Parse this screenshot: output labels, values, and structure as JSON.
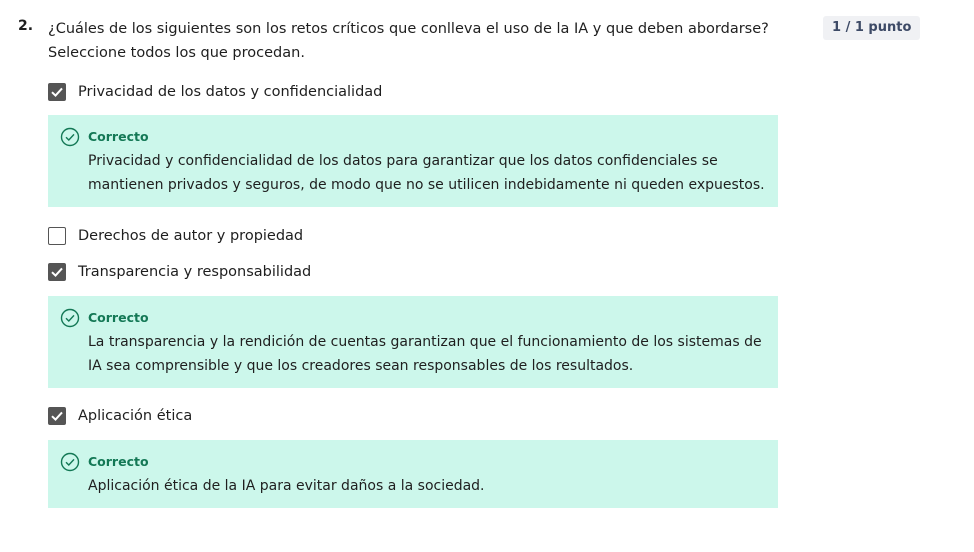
{
  "question": {
    "number": "2.",
    "text": "¿Cuáles de los siguientes son los retos críticos que conlleva el uso de la IA y que deben abordarse? Seleccione todos los que procedan.",
    "score": "1 / 1 punto"
  },
  "options": [
    {
      "label": "Privacidad de los datos y confidencialidad",
      "checked": true,
      "feedback": {
        "title": "Correcto",
        "text": "Privacidad y confidencialidad de los datos para garantizar que los datos confidenciales se mantienen privados y seguros, de modo que no se utilicen indebidamente ni queden expuestos."
      }
    },
    {
      "label": "Derechos de autor y propiedad",
      "checked": false
    },
    {
      "label": "Transparencia y responsabilidad",
      "checked": true,
      "feedback": {
        "title": "Correcto",
        "text": "La transparencia y la rendición de cuentas garantizan que el funcionamiento de los sistemas de IA sea comprensible y que los creadores sean responsables de los resultados."
      }
    },
    {
      "label": "Aplicación ética",
      "checked": true,
      "feedback": {
        "title": "Correcto",
        "text": "Aplicación ética de la IA para evitar daños a la sociedad."
      }
    }
  ],
  "icons": {
    "checkbox_checked": "check-icon",
    "feedback": "check-circle-icon"
  },
  "colors": {
    "feedback_bg": "#ccf7eb",
    "correct_green": "#137855",
    "checkbox": "#555555",
    "score_badge_bg": "#f0f1f4"
  }
}
